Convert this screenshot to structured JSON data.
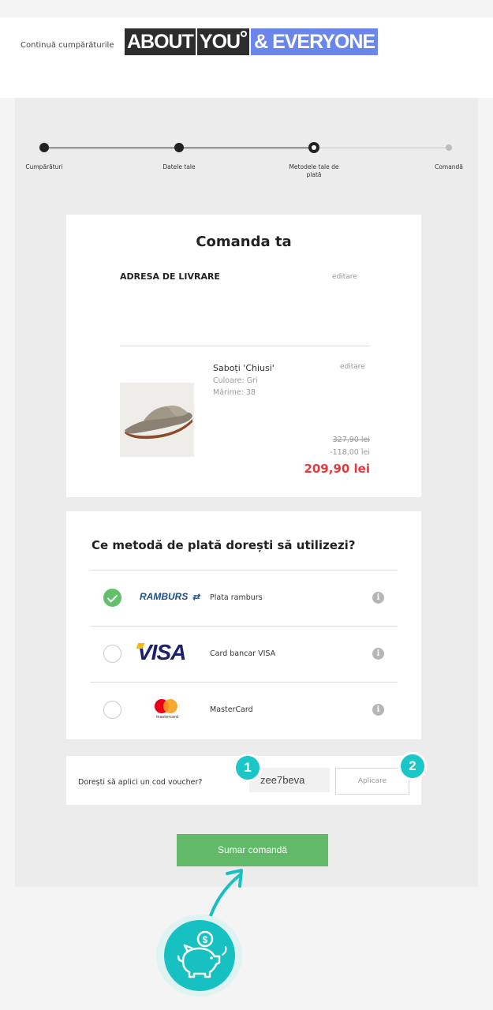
{
  "header": {
    "continue_link": "Continuă cumpărăturile",
    "logo_part1": "ABOUT",
    "logo_part2": "YOU",
    "logo_part3": "& EVERYONE"
  },
  "stepper": {
    "steps": [
      {
        "label": "Cumpărături",
        "state": "done"
      },
      {
        "label": "Datele tale",
        "state": "done"
      },
      {
        "label": "Metodele tale de plată",
        "state": "current"
      },
      {
        "label": "Comandă",
        "state": "pending"
      }
    ]
  },
  "order": {
    "title": "Comanda ta",
    "address_title": "ADRESA DE LIVRARE",
    "edit_label": "editare",
    "product": {
      "name": "Saboți 'Chiusi'",
      "color": "Culoare: Gri",
      "size": "Mărime: 38",
      "price_old": "327,90 lei",
      "discount": "-118,00 lei",
      "price_new": "209,90 lei"
    }
  },
  "payment": {
    "title": "Ce metodă de plată dorești să utilizezi?",
    "methods": [
      {
        "brand": "RAMBURS",
        "label": "Plata ramburs",
        "selected": true
      },
      {
        "brand": "VISA",
        "label": "Card bancar VISA",
        "selected": false
      },
      {
        "brand": "mastercard",
        "label": "MasterCard",
        "selected": false
      }
    ],
    "info_glyph": "i"
  },
  "voucher": {
    "question": "Dorești să aplici un cod voucher?",
    "code_value": "zee7beva",
    "apply_label": "Aplicare",
    "badge_1": "1",
    "badge_2": "2"
  },
  "summary_button": "Sumar comandă",
  "colors": {
    "accent_green": "#62b96a",
    "badge_teal": "#1bc6c6",
    "price_red": "#e8383c",
    "logo_blue": "#6b86ea"
  }
}
